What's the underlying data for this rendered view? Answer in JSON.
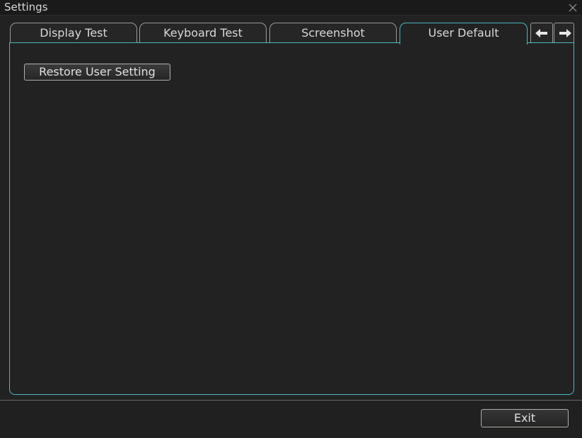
{
  "window": {
    "title": "Settings"
  },
  "tabs": [
    {
      "label": "Display Test",
      "active": false
    },
    {
      "label": "Keyboard Test",
      "active": false
    },
    {
      "label": "Screenshot",
      "active": false
    },
    {
      "label": "User Default",
      "active": true
    }
  ],
  "tab_nav": {
    "prev_icon": "arrow-left-icon",
    "next_icon": "arrow-right-icon"
  },
  "content": {
    "restore_button_label": "Restore User Setting"
  },
  "footer": {
    "exit_label": "Exit"
  },
  "colors": {
    "accent": "#4ab8c4",
    "background": "#222222",
    "text": "#d8d8d8"
  }
}
